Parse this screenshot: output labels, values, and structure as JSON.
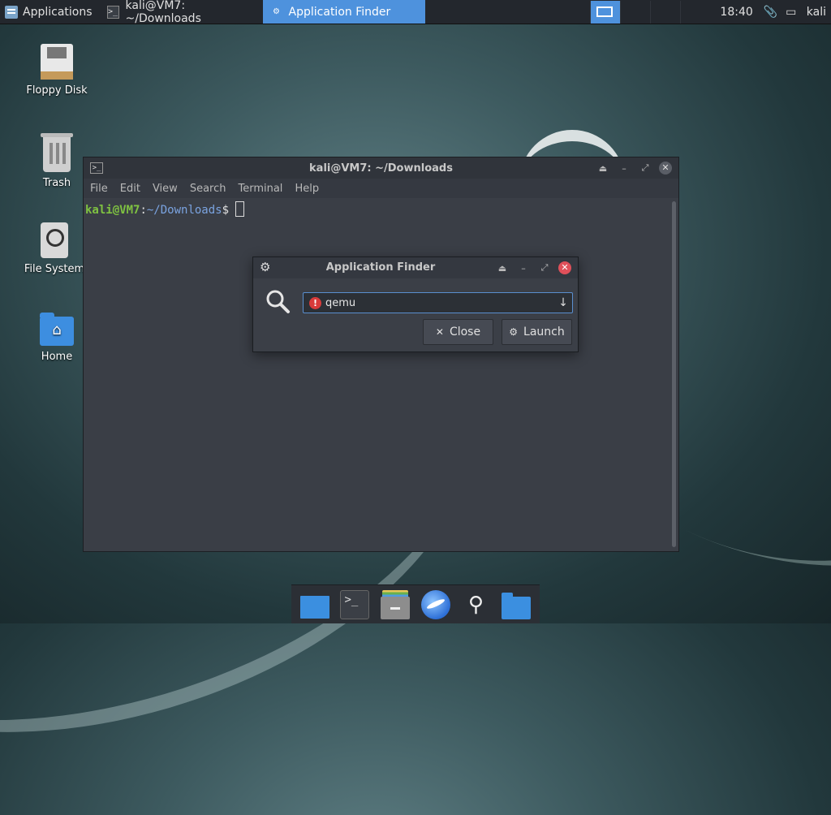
{
  "top_panel": {
    "applications_label": "Applications",
    "tasks": [
      {
        "label": "kali@VM7: ~/Downloads",
        "icon": "terminal-icon"
      },
      {
        "label": "Application Finder",
        "icon": "gear-icon"
      }
    ],
    "clock": "18:40",
    "user": "kali"
  },
  "desktop_icons": [
    {
      "label": "Floppy Disk",
      "icon": "floppy-disk-icon"
    },
    {
      "label": "Trash",
      "icon": "trash-icon"
    },
    {
      "label": "File System",
      "icon": "file-system-icon"
    },
    {
      "label": "Home",
      "icon": "home-folder-icon"
    }
  ],
  "terminal": {
    "title": "kali@VM7: ~/Downloads",
    "menu": [
      "File",
      "Edit",
      "View",
      "Search",
      "Terminal",
      "Help"
    ],
    "prompt_user": "kali@VM7",
    "prompt_colon": ":",
    "prompt_path": "~/Downloads",
    "prompt_symbol": "$"
  },
  "finder": {
    "title": "Application Finder",
    "search_value": "qemu",
    "close_label": "Close",
    "launch_label": "Launch"
  },
  "dock": [
    "show-desktop-icon",
    "terminal-icon",
    "file-manager-icon",
    "web-browser-icon",
    "app-finder-search-icon",
    "folder-icon"
  ],
  "colors": {
    "accent": "#4e92dd",
    "prompt_user": "#7fc241",
    "prompt_path": "#7aa3e0",
    "error": "#d83b3b"
  }
}
